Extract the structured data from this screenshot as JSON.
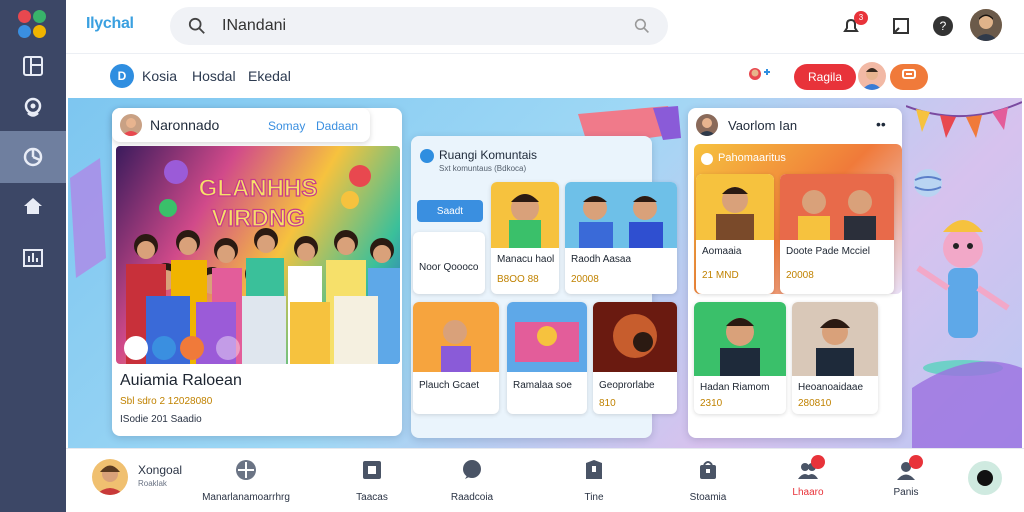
{
  "app": {
    "brand": "Ilychal",
    "search_value": "INandani"
  },
  "topbar": {
    "notif_count": "3"
  },
  "subbar": {
    "links": [
      "Kosia",
      "Hosdal",
      "Ekedal"
    ],
    "btn_red": "Ragila",
    "btn_orange": ""
  },
  "left_card": {
    "user": "Naronnado",
    "tab1": "Somay",
    "tab2": "Dadaan",
    "banner": "GLANHHS VIRDNG",
    "title": "Auiamia Raloean",
    "meta": "Sbl sdro 2 12028080",
    "sub": "ISodie 201 Saadio"
  },
  "middle_card": {
    "heading": "Ruangi Komuntais",
    "subheading": "Sxt komuntaus (Bdkoca)",
    "button": "Saadt",
    "tiles": [
      {
        "t1": "Noor Qoooco",
        "t2": ""
      },
      {
        "t1": "Manacu haol",
        "t2": "B8OO 88"
      },
      {
        "t1": "Raodh Aasaa",
        "t2": "20008"
      },
      {
        "t1": "Plauch Gcaet",
        "t2": ""
      },
      {
        "t1": "Ramalaa soe",
        "t2": ""
      },
      {
        "t1": "Geoprorlabe",
        "t2": "810"
      }
    ]
  },
  "right_card": {
    "user": "Vaorlom Ian",
    "heading": "Pahomaaritus",
    "tiles": [
      {
        "t1": "Aomaaia",
        "t2": "21 MND"
      },
      {
        "t1": "Doote Pade Mcciel",
        "t2": "20008"
      },
      {
        "t1": "Hadan Riamom",
        "t2": "2310"
      },
      {
        "t1": "Heoanoaidaae",
        "t2": "280810"
      }
    ]
  },
  "bottom_nav": {
    "profile_name": "Xongoal",
    "profile_sub": "Roaklak",
    "items": [
      "Manarlanamoarrhrg",
      "Taacas",
      "Raadcoia",
      "Tine",
      "Stoamia",
      "Lhaaro",
      "Panis"
    ]
  },
  "colors": {
    "accent_red": "#e8333a",
    "accent_orange": "#f07a3a",
    "brand_blue": "#3aa0e0",
    "rail": "#3c4766"
  }
}
